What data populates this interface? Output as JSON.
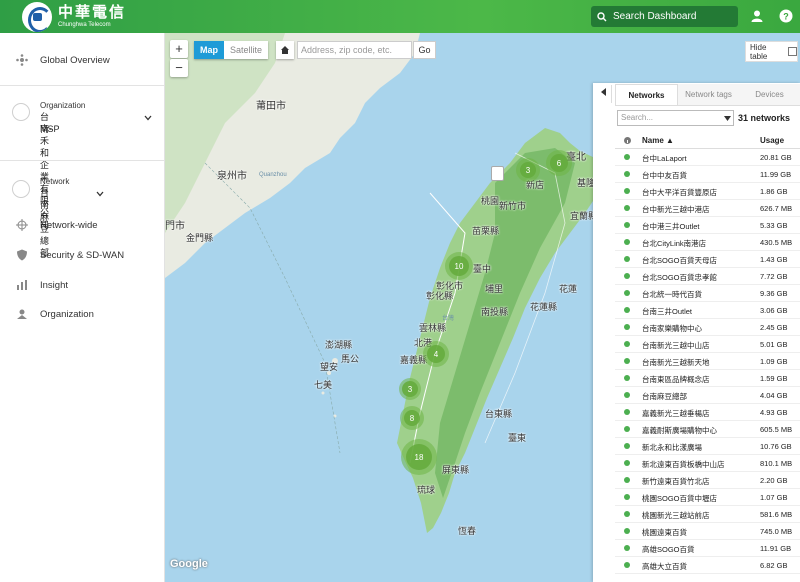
{
  "brand": {
    "name_cn": "中華電信",
    "name_en": "Chunghwa Telecom",
    "color_primary": "#3aa83f",
    "color_logo": "#1f5fa8"
  },
  "header": {
    "search_label": "Search Dashboard",
    "user_icon": "user-icon",
    "help_icon": "help-icon"
  },
  "sidebar": {
    "global_overview": "Global Overview",
    "organization": {
      "label": "Organization",
      "name_line1": "台南-禾和企業有限公司-",
      "name_line2": "MSP"
    },
    "network": {
      "label": "Network",
      "name": "台南麻豆總部"
    },
    "items": [
      {
        "label": "Network-wide",
        "icon": "network-wide-icon"
      },
      {
        "label": "Security & SD-WAN",
        "icon": "shield-icon"
      },
      {
        "label": "Insight",
        "icon": "chart-icon"
      },
      {
        "label": "Organization",
        "icon": "building-icon"
      }
    ]
  },
  "map": {
    "zoom_in": "+",
    "zoom_out": "−",
    "type_map": "Map",
    "type_satellite": "Satellite",
    "address_placeholder": "Address, zip code, etc.",
    "go": "Go",
    "hide_table": "Hide table",
    "google": "Google",
    "labels": {
      "putian": "莆田市",
      "quanzhou": "泉州市",
      "qz_en": "Quanzhou",
      "xiamen": "門市",
      "jinmen": "金門縣",
      "taipei": "臺北",
      "jilong": "基隆市",
      "taoyuan": "桃園",
      "xinzhu": "新竹縣",
      "yilan": "宜蘭縣",
      "miaoli": "苗栗縣",
      "taichung": "臺中",
      "zhanghua": "彰化縣",
      "zhanghuashi": "彰化市",
      "puli": "埔里",
      "nantou": "南投縣",
      "hualien": "花蓮縣",
      "hualien2": "花蓮",
      "yunlin": "雲林縣",
      "taiwan": "台灣",
      "beigang": "北港",
      "jiayi": "嘉義縣",
      "penghu": "澎湖縣",
      "magong": "馬公",
      "wangan": "望安",
      "qimei": "七美",
      "taitung": "台東縣",
      "tainan": "台南",
      "taidong": "臺東",
      "pingdong": "屏東縣",
      "liuqiu": "琉球",
      "hengchun": "恆春",
      "zhubei": "新竹市",
      "xindian": "新店",
      "ruifang": "瑞芳"
    },
    "clusters": [
      "3",
      "6",
      "10",
      "4",
      "3",
      "8",
      "18"
    ]
  },
  "panel": {
    "tabs": [
      "Networks",
      "Network tags",
      "Devices"
    ],
    "search_placeholder": "Search...",
    "count": "31 networks",
    "col_name": "Name ▲",
    "col_usage": "Usage",
    "status_color": "#4caf50",
    "rows": [
      {
        "name": "台中LaLaport",
        "usage": "20.81 GB"
      },
      {
        "name": "台中中友百貨",
        "usage": "11.99 GB"
      },
      {
        "name": "台中大平洋百貨豐原店",
        "usage": "1.86 GB"
      },
      {
        "name": "台中新光三越中港店",
        "usage": "626.7 MB"
      },
      {
        "name": "台中港三井Outlet",
        "usage": "5.33 GB"
      },
      {
        "name": "台北CityLink南港店",
        "usage": "430.5 MB"
      },
      {
        "name": "台北SOGO百貨天母店",
        "usage": "1.43 GB"
      },
      {
        "name": "台北SOGO百貨忠孝館",
        "usage": "7.72 GB"
      },
      {
        "name": "台北統一時代百貨",
        "usage": "9.36 GB"
      },
      {
        "name": "台南三井Outlet",
        "usage": "3.06 GB"
      },
      {
        "name": "台南家樂購物中心",
        "usage": "2.45 GB"
      },
      {
        "name": "台南新光三越中山店",
        "usage": "5.01 GB"
      },
      {
        "name": "台南新光三越新天地",
        "usage": "1.09 GB"
      },
      {
        "name": "台南東區品牌概念店",
        "usage": "1.59 GB"
      },
      {
        "name": "台南麻豆總部",
        "usage": "4.04 GB"
      },
      {
        "name": "嘉義新光三越垂楊店",
        "usage": "4.93 GB"
      },
      {
        "name": "嘉義耐斯廣場購物中心",
        "usage": "605.5 MB"
      },
      {
        "name": "新北永和比漾廣場",
        "usage": "10.76 GB"
      },
      {
        "name": "新北遠東百貨板橋中山店",
        "usage": "810.1 MB"
      },
      {
        "name": "新竹遠東百貨竹北店",
        "usage": "2.20 GB"
      },
      {
        "name": "桃園SOGO百貨中壢店",
        "usage": "1.07 GB"
      },
      {
        "name": "桃園新光三越站前店",
        "usage": "581.6 MB"
      },
      {
        "name": "桃園遠東百貨",
        "usage": "745.0 MB"
      },
      {
        "name": "高雄SOGO百貨",
        "usage": "11.91 GB"
      },
      {
        "name": "高雄大立百貨",
        "usage": "6.82 GB"
      }
    ]
  }
}
